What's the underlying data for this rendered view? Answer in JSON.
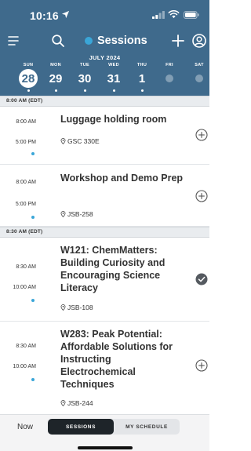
{
  "status_bar": {
    "time": "10:16"
  },
  "nav": {
    "title": "Sessions"
  },
  "week": {
    "month": "JULY 2024",
    "days": [
      {
        "abbr": "SUN",
        "num": "28"
      },
      {
        "abbr": "MON",
        "num": "29"
      },
      {
        "abbr": "TUE",
        "num": "30"
      },
      {
        "abbr": "WED",
        "num": "31"
      },
      {
        "abbr": "THU",
        "num": "1"
      },
      {
        "abbr": "FRI",
        "num": ""
      },
      {
        "abbr": "SAT",
        "num": ""
      }
    ]
  },
  "sections": [
    {
      "label": "8:00 AM (EDT)"
    },
    {
      "label": "8:30 AM (EDT)"
    }
  ],
  "sessions": [
    {
      "start": "8:00 AM",
      "end": "5:00 PM",
      "title": "Luggage holding room",
      "location": "GSC 330E",
      "in_schedule": false
    },
    {
      "start": "8:00 AM",
      "end": "5:00 PM",
      "title": "Workshop and Demo Prep",
      "location": "JSB-258",
      "in_schedule": false
    },
    {
      "start": "8:30 AM",
      "end": "10:00 AM",
      "title": "W121: ChemMatters: Building Curiosity and Encouraging Science Literacy",
      "location": "JSB-108",
      "in_schedule": true
    },
    {
      "start": "8:30 AM",
      "end": "10:00 AM",
      "title": "W283: Peak Potential: Affordable Solutions for Instructing Electrochemical Techniques",
      "location": "JSB-244",
      "in_schedule": false
    }
  ],
  "bottom": {
    "now_label": "Now",
    "tab_sessions": "SESSIONS",
    "tab_my_schedule": "MY SCHEDULE"
  },
  "colors": {
    "header_bg": "#3f6a8c",
    "accent_dot": "#3aa6d8",
    "active_tab_bg": "#1e2429"
  },
  "icons": [
    "location-arrow-icon",
    "signal-icon",
    "wifi-icon",
    "battery-icon",
    "menu-icon",
    "search-icon",
    "plus-icon",
    "account-icon",
    "pin-icon",
    "add-circle-icon",
    "check-circle-icon"
  ]
}
